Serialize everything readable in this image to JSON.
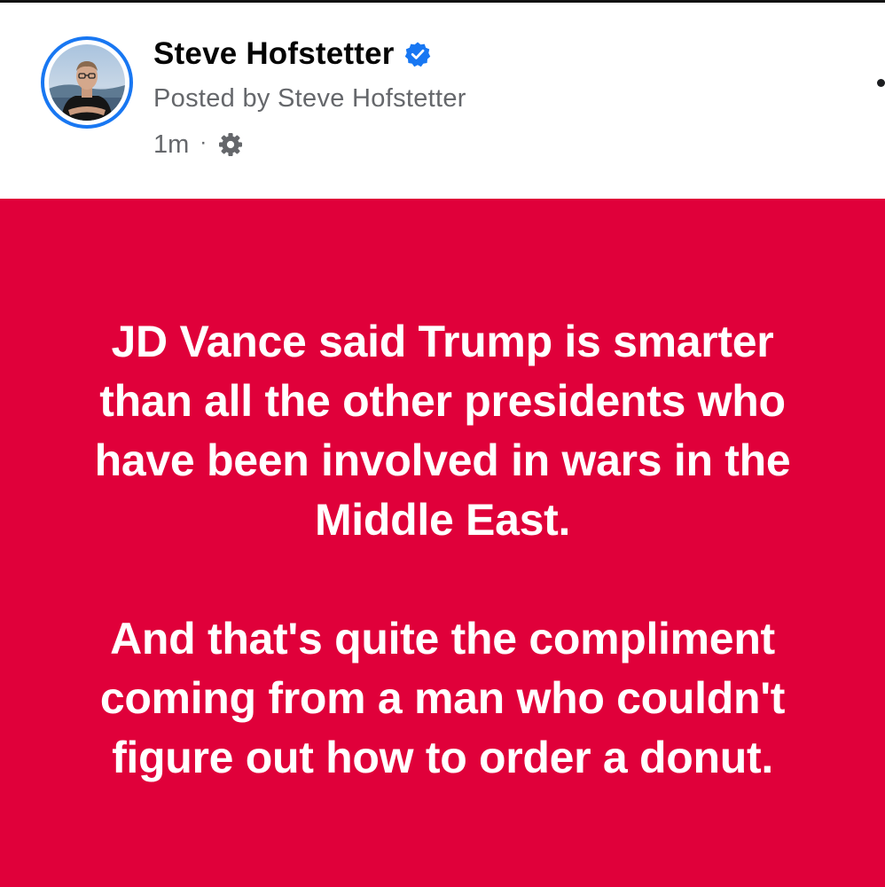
{
  "post": {
    "author": {
      "name": "Steve Hofstetter",
      "verified": true,
      "verified_badge_icon": "verified-badge-icon",
      "avatar_icon": "profile-photo"
    },
    "posted_by": "Posted by Steve Hofstetter",
    "timestamp": "1m",
    "separator": "·",
    "privacy_icon": "gear-icon",
    "more_icon": "more-options-icon",
    "background_color": "#e0003a",
    "text_color": "#ffffff",
    "accent_color": "#1877f2",
    "paragraphs": [
      "JD Vance said Trump is smarter\nthan all the other presidents who\nhave been involved in wars in the\nMiddle East.",
      "And that's quite the compliment\ncoming from a man who couldn't\nfigure out how to order a donut."
    ]
  }
}
